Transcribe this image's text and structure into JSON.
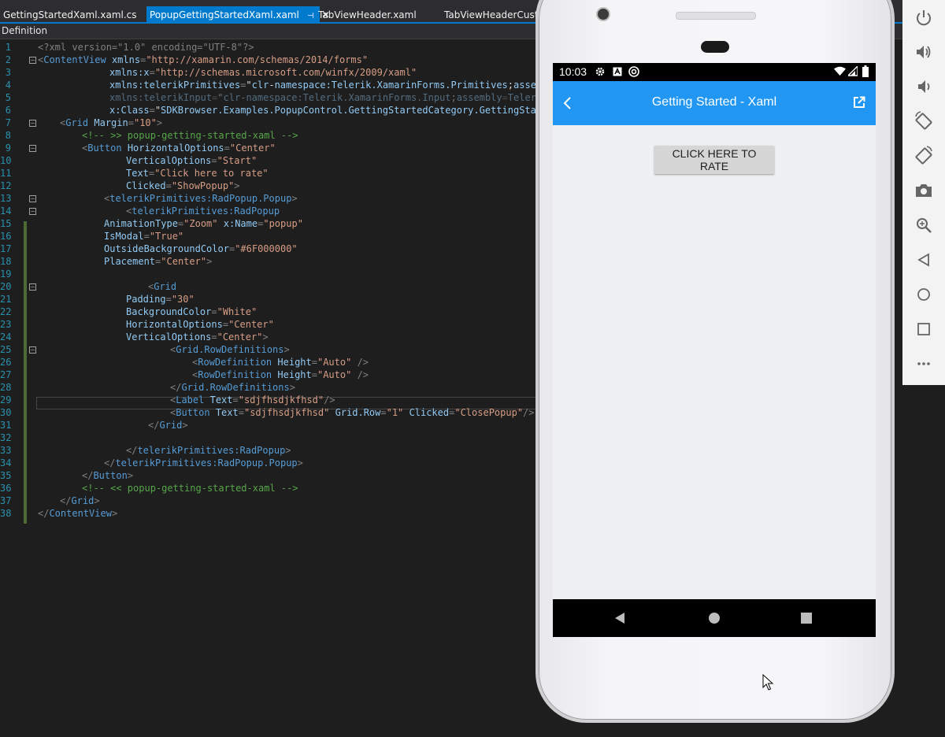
{
  "ide": {
    "tabs": [
      {
        "label": "GettingStartedXaml.xaml.cs",
        "active": false
      },
      {
        "label": "PopupGettingStartedXaml.xaml",
        "active": true,
        "pin": "⊣",
        "close": "✕"
      },
      {
        "label": "TabViewHeader.xaml",
        "active": false
      },
      {
        "label": "TabViewHeaderCustom",
        "active": false
      }
    ],
    "navigation_bar": "Definition",
    "line_numbers": [
      "1",
      "2",
      "3",
      "4",
      "5",
      "6",
      "7",
      "8",
      "9",
      "10",
      "11",
      "12",
      "13",
      "14",
      "15",
      "16",
      "17",
      "18",
      "19",
      "20",
      "21",
      "22",
      "23",
      "24",
      "25",
      "26",
      "27",
      "28",
      "29",
      "30",
      "31",
      "32",
      "33",
      "34",
      "35",
      "36",
      "37",
      "38"
    ],
    "code_lines": [
      "<?xml version=\"1.0\" encoding=\"UTF-8\"?>",
      "<ContentView xmlns=\"http://xamarin.com/schemas/2014/forms\"",
      "xmlns:x=\"http://schemas.microsoft.com/winfx/2009/xaml\"",
      "xmlns:telerikPrimitives=\"clr-namespace:Telerik.XamarinForms.Primitives;assemb",
      "xmlns:telerikInput=\"clr-namespace:Telerik.XamarinForms.Input;assembly=Telerik",
      "x:Class=\"SDKBrowser.Examples.PopupControl.GettingStartedCategory.GettingStart",
      "<Grid Margin=\"10\">",
      "<!-- >> popup-getting-started-xaml -->",
      "<Button HorizontalOptions=\"Center\"",
      "VerticalOptions=\"Start\"",
      "Text=\"Click here to rate\"",
      "Clicked=\"ShowPopup\">",
      "<telerikPrimitives:RadPopup.Popup>",
      "<telerikPrimitives:RadPopup",
      "AnimationType=\"Zoom\" x:Name=\"popup\"",
      "IsModal=\"True\"",
      "OutsideBackgroundColor=\"#6F000000\"",
      "Placement=\"Center\">",
      "",
      "<Grid",
      "Padding=\"30\"",
      "BackgroundColor=\"White\"",
      "HorizontalOptions=\"Center\"",
      "VerticalOptions=\"Center\">",
      "<Grid.RowDefinitions>",
      "<RowDefinition Height=\"Auto\" />",
      "<RowDefinition Height=\"Auto\" />",
      "</Grid.RowDefinitions>",
      "<Label Text=\"sdjfhsdjkfhsd\"/>",
      "<Button Text=\"sdjfhsdjkfhsd\" Grid.Row=\"1\" Clicked=\"ClosePopup\"/>",
      "</Grid>",
      "",
      "</telerikPrimitives:RadPopup>",
      "</telerikPrimitives:RadPopup.Popup>",
      "</Button>",
      "<!-- << popup-getting-started-xaml -->",
      "</Grid>",
      "</ContentView>"
    ]
  },
  "phone": {
    "status_time": "10:03",
    "app_title": "Getting Started - Xaml",
    "rate_button_label": "CLICK HERE TO RATE",
    "appbar_color": "#2196f3"
  },
  "emulator_toolbar": {
    "items": [
      "power-icon",
      "volume-up-icon",
      "volume-down-icon",
      "rotate-left-icon",
      "rotate-right-icon",
      "camera-icon",
      "zoom-icon",
      "back-icon",
      "home-icon",
      "overview-icon",
      "more-icon"
    ]
  }
}
